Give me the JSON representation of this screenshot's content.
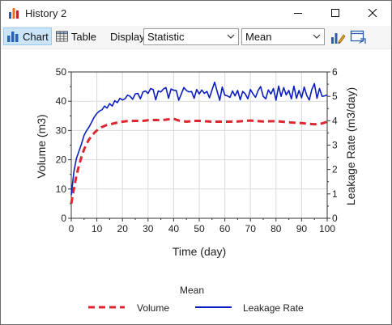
{
  "window": {
    "title": "History 2",
    "controls": {
      "minimize": "minimize",
      "maximize": "maximize",
      "close": "close"
    }
  },
  "toolbar": {
    "chart_label": "Chart",
    "table_label": "Table",
    "display_label": "Display:",
    "display_select_value": "Statistic",
    "statistic_select_value": "Mean"
  },
  "colors": {
    "volume": "#dd2630",
    "leakage": "#0a1ebf",
    "grid": "#d9d9d9",
    "selected_tab": "#cce4f7"
  },
  "chart_data": {
    "type": "line",
    "xlabel": "Time (day)",
    "ylabel_left": "Volume (m3)",
    "ylabel_right": "Leakage Rate (m3/day)",
    "xlim": [
      0,
      100
    ],
    "ylim_left": [
      0,
      50
    ],
    "ylim_right": [
      0,
      6
    ],
    "x_ticks": [
      0,
      10,
      20,
      30,
      40,
      50,
      60,
      70,
      80,
      90,
      100
    ],
    "y_left_ticks": [
      0,
      10,
      20,
      30,
      40,
      50
    ],
    "y_right_ticks": [
      0,
      1,
      2,
      3,
      4,
      5,
      6
    ],
    "grid": true,
    "legend_title": "Mean",
    "legend_position": "bottom",
    "series": [
      {
        "name": "Volume",
        "axis": "left",
        "style": "dashed",
        "x": [
          0,
          1,
          2,
          3,
          4,
          5,
          6,
          7,
          8,
          9,
          10,
          12,
          14,
          16,
          18,
          20,
          22,
          25,
          28,
          30,
          33,
          35,
          38,
          40,
          42,
          45,
          48,
          50,
          55,
          60,
          65,
          70,
          75,
          80,
          85,
          90,
          95,
          98,
          100
        ],
        "values": [
          5,
          10,
          14.5,
          18,
          21,
          23.5,
          25.5,
          27,
          28.2,
          29.2,
          30,
          31.2,
          31.9,
          32.3,
          32.7,
          33,
          33.2,
          33.3,
          33.3,
          33.5,
          33.6,
          33.5,
          33.8,
          34,
          33.4,
          33,
          33.3,
          33.3,
          33,
          33,
          33.1,
          33.4,
          33.1,
          33.2,
          32.8,
          32.5,
          32.1,
          32.4,
          33
        ]
      },
      {
        "name": "Leakage Rate",
        "axis": "right",
        "style": "solid",
        "x": [
          0,
          1,
          2,
          3,
          4,
          5,
          6,
          7,
          8,
          9,
          10,
          11,
          12,
          13,
          14,
          15,
          16,
          17,
          18,
          19,
          20,
          21,
          22,
          23,
          24,
          25,
          26,
          27,
          28,
          29,
          30,
          31,
          32,
          33,
          34,
          35,
          36,
          37,
          38,
          39,
          40,
          41,
          42,
          43,
          44,
          45,
          46,
          47,
          48,
          49,
          50,
          51,
          52,
          53,
          54,
          55,
          56,
          57,
          58,
          59,
          60,
          61,
          62,
          63,
          64,
          65,
          66,
          67,
          68,
          69,
          70,
          71,
          72,
          73,
          74,
          75,
          76,
          77,
          78,
          79,
          80,
          81,
          82,
          83,
          84,
          85,
          86,
          87,
          88,
          89,
          90,
          91,
          92,
          93,
          94,
          95,
          96,
          97,
          98,
          99,
          100
        ],
        "values": [
          0.95,
          1.9,
          2.45,
          2.75,
          3.05,
          3.4,
          3.6,
          3.75,
          3.95,
          4.15,
          4.3,
          4.4,
          4.45,
          4.6,
          4.52,
          4.7,
          4.6,
          4.82,
          4.74,
          4.92,
          4.85,
          4.9,
          5.05,
          5.0,
          4.88,
          5.1,
          5.12,
          4.9,
          5.18,
          5.22,
          5.12,
          5.32,
          5.28,
          4.86,
          5.22,
          5.18,
          5.3,
          5.36,
          4.92,
          5.3,
          5.25,
          5.24,
          4.84,
          5.1,
          5.36,
          5.24,
          5.18,
          5.2,
          4.92,
          5.28,
          5.1,
          5.26,
          5.12,
          5.2,
          4.94,
          5.26,
          5.58,
          5.2,
          4.84,
          5.38,
          5.05,
          5.02,
          4.96,
          5.22,
          5.02,
          5.24,
          4.86,
          5.2,
          5.1,
          4.9,
          5.28,
          5.1,
          4.96,
          5.24,
          5.4,
          5.0,
          4.9,
          5.26,
          5.1,
          5.32,
          4.84,
          5.42,
          5.0,
          5.36,
          5.06,
          5.24,
          4.9,
          5.42,
          4.92,
          5.24,
          4.94,
          5.38,
          5.04,
          4.85,
          5.28,
          5.52,
          4.92,
          5.32,
          5.0,
          5.02,
          5.06
        ]
      }
    ]
  }
}
